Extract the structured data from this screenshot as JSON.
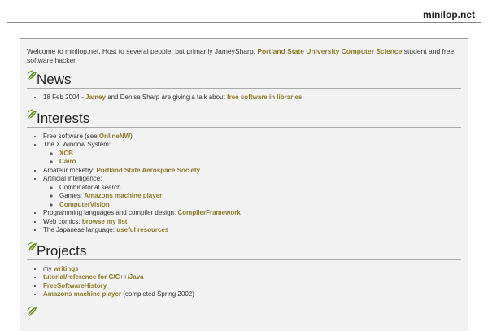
{
  "site": {
    "title": "minilop.net"
  },
  "intro": {
    "text_before": "Welcome to minilop.net. Host to several people, but primarily JameySharp, ",
    "link": "Portland State University Computer Science",
    "text_after": " student and free software hacker."
  },
  "news": {
    "heading": "News",
    "items": [
      {
        "date": "18 Feb 2004 - ",
        "link1": "Jamey",
        "middle": " and Denise Sharp are giving a talk about ",
        "link2": "free software in libraries",
        "end": "."
      }
    ]
  },
  "interests": {
    "heading": "Interests",
    "free_software": {
      "text": "Free software (see ",
      "link": "OnlineNW",
      "end": ")"
    },
    "x_window": {
      "text": "The X Window System:",
      "sub": [
        "XCB",
        "Cairo"
      ]
    },
    "rocketry": {
      "text": "Amateur rocketry: ",
      "link": "Portland State Aerospace Society"
    },
    "ai": {
      "text": "Artificial intelligence:",
      "combinatorial": "Combinatorial search",
      "games_text": "Games: ",
      "games_link": "Amazons machine player",
      "vision_link": "ComputerVision"
    },
    "languages": {
      "text": "Programming languages and compiler design: ",
      "link": "CompilerFramework"
    },
    "comics": {
      "text": "Web comics: ",
      "link": "browse my list"
    },
    "japanese": {
      "text": "The Japanese language: ",
      "link": "useful resources"
    }
  },
  "projects": {
    "heading": "Projects",
    "writings": {
      "text": "my ",
      "link": "writings"
    },
    "tutorial": "tutorial/reference for C/C++/Java",
    "history": "FreeSoftwareHistory",
    "amazons": {
      "link": "Amazons machine player",
      "text": " (completed Spring 2002)"
    }
  },
  "icons": {
    "leaf": "leaf-icon"
  },
  "colors": {
    "link": "#8a7a2a",
    "panel": "#f2f2f2",
    "leaf": "#6d8c2a"
  }
}
